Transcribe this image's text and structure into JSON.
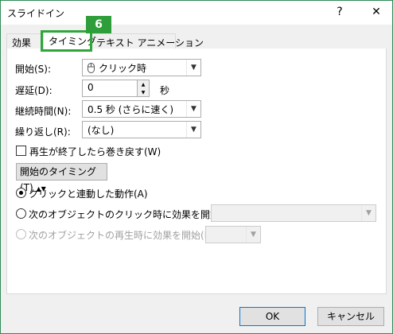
{
  "window": {
    "title": "スライドイン",
    "help_label": "?",
    "close_label": "✕"
  },
  "annotation": {
    "step_number": "6"
  },
  "tabs": [
    {
      "label": "効果"
    },
    {
      "label": "タイミング"
    },
    {
      "label": "テキスト アニメーション"
    }
  ],
  "fields": {
    "start": {
      "label": "開始(S):",
      "value": "クリック時",
      "icon": "mouse-click-icon"
    },
    "delay": {
      "label": "遅延(D):",
      "value": "0",
      "unit": "秒"
    },
    "duration": {
      "label": "継続時間(N):",
      "value": "0.5 秒 (さらに速く)"
    },
    "repeat": {
      "label": "繰り返し(R):",
      "value": "(なし)"
    }
  },
  "rewind": {
    "label": "再生が終了したら巻き戻す(W)",
    "checked": false
  },
  "triggers": {
    "toggle_label": "開始のタイミング(T)",
    "option_click": "クリックと連動した動作(A)",
    "option_sequence": "次のオブジェクトのクリック時に効果を開始(C):",
    "option_media": "次のオブジェクトの再生時に効果を開始(P):"
  },
  "buttons": {
    "ok": "OK",
    "cancel": "キャンセル"
  },
  "colors": {
    "annotation_green": "#2e9e3a",
    "primary_border": "#0078d7"
  }
}
